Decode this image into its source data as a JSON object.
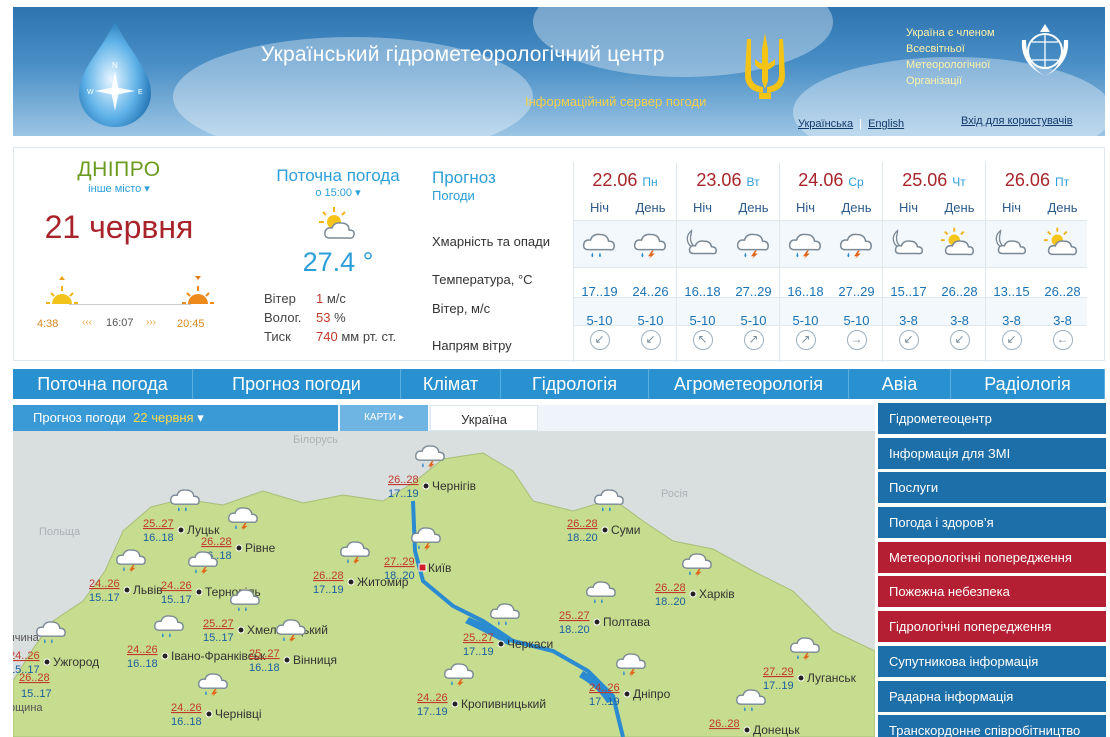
{
  "header": {
    "title": "Український гідрометеорологічний центр",
    "subtitle": "Інформаційний сервер погоди",
    "wmo_line1": "Україна є членом",
    "wmo_line2": "Всесвітньої",
    "wmo_line3": "Метеорологічної",
    "wmo_line4": "Організації",
    "lang_ua": "Українська",
    "lang_sep": "|",
    "lang_en": "English",
    "login": "Вхід для користувачів",
    "colors": {
      "gradient_top": "#2d74b0",
      "gradient_bottom": "#9cc5e4",
      "title": "#ffffff",
      "subtitle": "#f5d04a"
    }
  },
  "city": {
    "name": "ДНІПРО",
    "other": "інше місто",
    "date": "21 червня",
    "sunrise": "4:38",
    "daylength": "16:07",
    "sunset": "20:45",
    "arrows_left": "‹‹‹",
    "arrows_right": "›››"
  },
  "current": {
    "heading": "Поточна погода",
    "time": "о 15:00",
    "temp": "27.4 °",
    "wind_label": "Вітер",
    "wind_value": "1",
    "wind_unit": "м/с",
    "hum_label": "Волог.",
    "hum_value": "53",
    "hum_unit": "%",
    "press_label": "Тиск",
    "press_value": "740",
    "press_unit": "мм рт. ст.",
    "icon": "sun-cloud-icon"
  },
  "forecast": {
    "title": "Прогноз",
    "subtitle": "Погоди",
    "labels": {
      "clouds": "Хмарність та опади",
      "temp": "Температура, °C",
      "wind": "Вітер, м/с",
      "dir": "Напрям вітру"
    },
    "days": [
      {
        "date": "22.06",
        "dow": "Пн",
        "night": {
          "tod": "Ніч",
          "icon": "cloud-rain-icon",
          "temp": "17..19",
          "wind": "5-10",
          "dir": "↙"
        },
        "day": {
          "tod": "День",
          "icon": "cloud-thunder-icon",
          "temp": "24..26",
          "wind": "5-10",
          "dir": "↙"
        }
      },
      {
        "date": "23.06",
        "dow": "Вт",
        "night": {
          "tod": "Ніч",
          "icon": "moon-cloud-icon",
          "temp": "16..18",
          "wind": "5-10",
          "dir": "↖"
        },
        "day": {
          "tod": "День",
          "icon": "cloud-thunder-icon",
          "temp": "27..29",
          "wind": "5-10",
          "dir": "↗"
        }
      },
      {
        "date": "24.06",
        "dow": "Ср",
        "night": {
          "tod": "Ніч",
          "icon": "cloud-thunder-icon",
          "temp": "16..18",
          "wind": "5-10",
          "dir": "↗"
        },
        "day": {
          "tod": "День",
          "icon": "cloud-thunder-icon",
          "temp": "27..29",
          "wind": "5-10",
          "dir": "→"
        }
      },
      {
        "date": "25.06",
        "dow": "Чт",
        "night": {
          "tod": "Ніч",
          "icon": "moon-cloud-icon",
          "temp": "15..17",
          "wind": "3-8",
          "dir": "↙"
        },
        "day": {
          "tod": "День",
          "icon": "sun-cloud-icon",
          "temp": "26..28",
          "wind": "3-8",
          "dir": "↙"
        }
      },
      {
        "date": "26.06",
        "dow": "Пт",
        "night": {
          "tod": "Ніч",
          "icon": "moon-cloud-icon",
          "temp": "13..15",
          "wind": "3-8",
          "dir": "↙"
        },
        "day": {
          "tod": "День",
          "icon": "sun-cloud-icon",
          "temp": "26..28",
          "wind": "3-8",
          "dir": "←"
        }
      }
    ]
  },
  "nav": [
    "Поточна погода",
    "Прогноз погоди",
    "Клімат",
    "Гідрологія",
    "Агрометеорологія",
    "Авіа",
    "Радіологія"
  ],
  "map": {
    "tab_forecast": "Прогноз погоди",
    "tab_forecast_date": "22 червня",
    "tab_maps": "КАРТИ",
    "tab_region": "Україна",
    "countries": [
      "Білорусь",
      "Польща",
      "Росія"
    ],
    "cities": [
      {
        "name": "Чернігів",
        "hi": "26..28",
        "lo": "17..19",
        "icon": "cloud-thunder-icon",
        "capital": false
      },
      {
        "name": "Луцьк",
        "hi": "25..27",
        "lo": "16..18",
        "icon": "cloud-rain-icon",
        "capital": false
      },
      {
        "name": "Рівне",
        "hi": "26..28",
        "lo": "16..18",
        "icon": "cloud-thunder-icon",
        "capital": false
      },
      {
        "name": "Суми",
        "hi": "26..28",
        "lo": "18..20",
        "icon": "cloud-rain-icon",
        "capital": false
      },
      {
        "name": "Київ",
        "hi": "27..29",
        "lo": "18..20",
        "icon": "cloud-thunder-icon",
        "capital": true
      },
      {
        "name": "Житомир",
        "hi": "26..28",
        "lo": "17..19",
        "icon": "cloud-thunder-icon",
        "capital": false
      },
      {
        "name": "Львів",
        "hi": "24..26",
        "lo": "15..17",
        "icon": "cloud-thunder-icon",
        "capital": false
      },
      {
        "name": "Тернопіль",
        "hi": "24..26",
        "lo": "15..17",
        "icon": "cloud-thunder-icon",
        "capital": false
      },
      {
        "name": "Харків",
        "hi": "26..28",
        "lo": "18..20",
        "icon": "cloud-thunder-icon",
        "capital": false
      },
      {
        "name": "Хмельницький",
        "hi": "25..27",
        "lo": "15..17",
        "icon": "cloud-rain-icon",
        "capital": false
      },
      {
        "name": "Полтава",
        "hi": "25..27",
        "lo": "18..20",
        "icon": "cloud-rain-icon",
        "capital": false
      },
      {
        "name": "Ужгород",
        "hi": "24..26",
        "lo": "15..17",
        "icon": "cloud-rain-icon",
        "capital": false
      },
      {
        "name": "Івано-Франківськ",
        "hi": "24..26",
        "lo": "16..18",
        "icon": "cloud-rain-icon",
        "capital": false
      },
      {
        "name": "Вінниця",
        "hi": "25..27",
        "lo": "16..18",
        "icon": "cloud-thunder-icon",
        "capital": false
      },
      {
        "name": "Черкаси",
        "hi": "25..27",
        "lo": "17..19",
        "icon": "cloud-rain-icon",
        "capital": false
      },
      {
        "name": "Луганськ",
        "hi": "27..29",
        "lo": "17..19",
        "icon": "cloud-thunder-icon",
        "capital": false
      },
      {
        "name": "Чернівці",
        "hi": "24..26",
        "lo": "16..18",
        "icon": "cloud-thunder-icon",
        "capital": false
      },
      {
        "name": "Кропивницький",
        "hi": "24..26",
        "lo": "17..19",
        "icon": "cloud-thunder-icon",
        "capital": false
      },
      {
        "name": "Дніпро",
        "hi": "24..26",
        "lo": "17..19",
        "icon": "cloud-thunder-icon",
        "capital": false
      },
      {
        "name": "Донецьк",
        "hi": "26..28",
        "lo": "",
        "icon": "cloud-rain-icon",
        "capital": false
      }
    ],
    "partial_labels": [
      "ччина",
      "26..28",
      "15..17",
      "рщина"
    ],
    "colors": {
      "land": "#c6dc8e",
      "foreign": "#dadfdf",
      "water": "#2a8bd0"
    }
  },
  "menu": [
    {
      "label": "Гідрометеоцентр",
      "style": "blue"
    },
    {
      "label": "Інформація для ЗМІ",
      "style": "blue"
    },
    {
      "label": "Послуги",
      "style": "blue"
    },
    {
      "label": "Погода і здоров’я",
      "style": "blue"
    },
    {
      "label": "Метеорологічні попередження",
      "style": "red"
    },
    {
      "label": "Пожежна небезпека",
      "style": "red"
    },
    {
      "label": "Гідрологічні попередження",
      "style": "red"
    },
    {
      "label": "Супутникова інформація",
      "style": "blue"
    },
    {
      "label": "Радарна інформація",
      "style": "blue"
    },
    {
      "label": "Транскордонне співробітництво",
      "style": "blue"
    }
  ]
}
